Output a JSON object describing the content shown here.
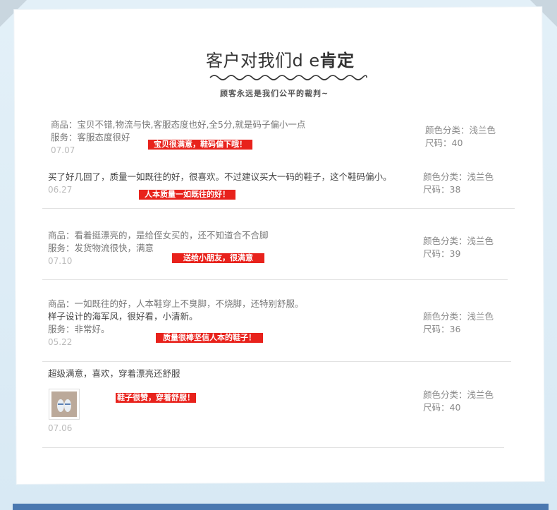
{
  "header": {
    "title_plain": "客户对我们d e",
    "title_bold": "肯定",
    "subtitle": "顾客永远是我们公平的裁判~"
  },
  "reviews": [
    {
      "lines": [
        "商品：宝贝不错,物流与快,客服态度也好,全5分,就是码子偏小一点",
        "服务：客服态度很好"
      ],
      "date": "07.07",
      "tag": "宝贝很满意，鞋码偏下哦！",
      "color_label": "颜色分类：浅兰色",
      "size_label": "尺码：40"
    },
    {
      "lines": [
        "买了好几回了，质量一如既往的好，很喜欢。不过建议买大一码的鞋子，这个鞋码偏小。"
      ],
      "date": "06.27",
      "tag": "人本质量一如既往的好！",
      "color_label": "颜色分类：浅兰色",
      "size_label": "尺码：38"
    },
    {
      "lines": [
        "商品：看着挺漂亮的，是给侄女买的，还不知道合不合脚",
        "服务：发货物流很快，满意"
      ],
      "date": "07.10",
      "tag": "送给小朋友，很满意",
      "color_label": "颜色分类：浅兰色",
      "size_label": "尺码：39"
    },
    {
      "lines": [
        "商品：一如既往的好，人本鞋穿上不臭脚，不烧脚，还特别舒服。",
        "样子设计的海军风，很好看，小清新。",
        "服务：非常好。"
      ],
      "date": "05.22",
      "tag": "质量很棒坚信人本的鞋子！",
      "color_label": "颜色分类：浅兰色",
      "size_label": "尺码：36"
    },
    {
      "lines": [
        "超级满意，喜欢，穿着漂亮还舒服"
      ],
      "date": "07.06",
      "tag": "鞋子很赞，穿着舒服！",
      "color_label": "颜色分类：浅兰色",
      "size_label": "尺码：40"
    }
  ]
}
